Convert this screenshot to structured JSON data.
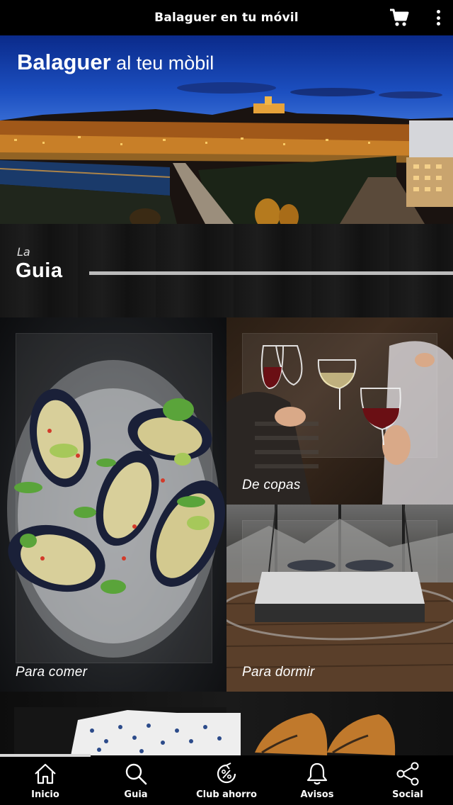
{
  "app_bar": {
    "title": "Balaguer en tu móvil",
    "cart_icon": "cart-icon",
    "menu_icon": "more-vertical-icon"
  },
  "hero": {
    "title_bold": "Balaguer",
    "title_rest": " al teu mòbil"
  },
  "guide": {
    "small": "La",
    "big": "Guia"
  },
  "tiles": [
    {
      "label": "Para comer"
    },
    {
      "label": "De copas"
    },
    {
      "label": "Para dormir"
    }
  ],
  "bottom_nav": [
    {
      "label": "Inicio",
      "icon": "home-icon"
    },
    {
      "label": "Guia",
      "icon": "search-icon"
    },
    {
      "label": "Club ahorro",
      "icon": "percent-icon"
    },
    {
      "label": "Avisos",
      "icon": "bell-icon"
    },
    {
      "label": "Social",
      "icon": "share-icon"
    }
  ]
}
